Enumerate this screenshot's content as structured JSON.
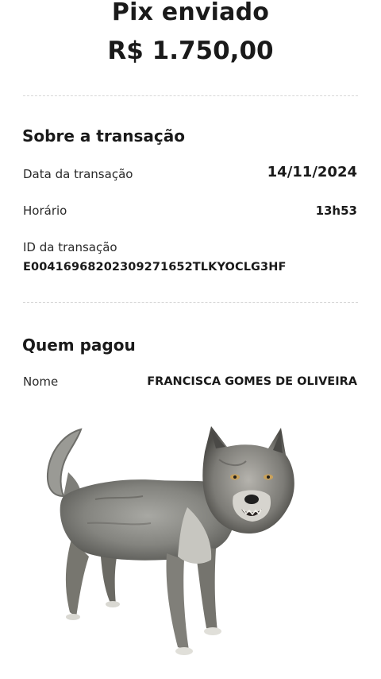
{
  "header": {
    "title": "Pix enviado",
    "amount": "R$ 1.750,00"
  },
  "transaction": {
    "section_title": "Sobre a transação",
    "date_label": "Data da transação",
    "date_value": "14/11/2024",
    "time_label": "Horário",
    "time_value": "13h53",
    "id_label": "ID da transação",
    "id_value": "E00416968202309271652TLKYOCLG3HF"
  },
  "payer": {
    "section_title": "Quem pagou",
    "name_label": "Nome",
    "name_value": "FRANCISCA GOMES DE OLIVEIRA"
  },
  "image": {
    "icon": "wolf-sticker",
    "fur_color": "#8a8a86",
    "fur_dark": "#4a4a47",
    "fur_light": "#cfcfca"
  }
}
